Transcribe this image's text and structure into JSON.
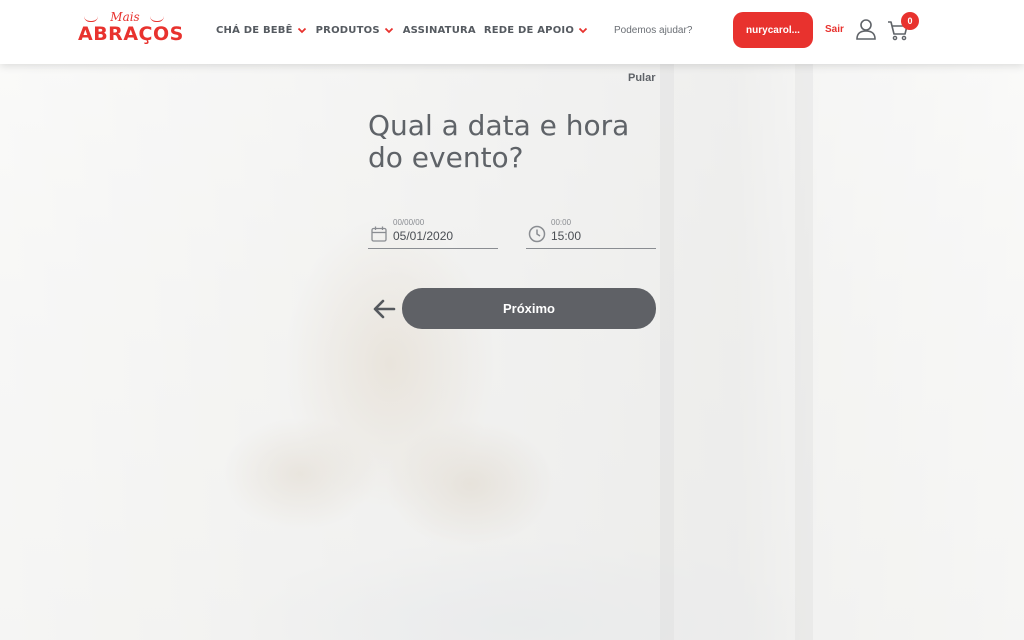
{
  "brand": {
    "logo_top": "Mais",
    "logo_main": "ABRAÇOS",
    "accent_color": "#e8322e"
  },
  "nav": {
    "items": [
      {
        "label": "CHÁ DE BEBÊ",
        "has_dropdown": true
      },
      {
        "label": "PRODUTOS",
        "has_dropdown": true
      },
      {
        "label": "ASSINATURA",
        "has_dropdown": false
      },
      {
        "label": "REDE DE APOIO",
        "has_dropdown": true
      }
    ]
  },
  "header": {
    "help_link": "Podemos ajudar?",
    "user_button": "nurycarol...",
    "logout": "Sair",
    "cart_count": "0",
    "user_icon": "user-icon",
    "cart_icon": "cart-icon"
  },
  "form": {
    "skip": "Pular",
    "question": "Qual a data e hora do evento?",
    "date_field": {
      "placeholder": "00/00/00",
      "value": "05/01/2020",
      "icon": "calendar-icon"
    },
    "time_field": {
      "placeholder": "00:00",
      "value": "15:00",
      "icon": "clock-icon"
    },
    "back_icon": "arrow-left-icon",
    "next_button": "Próximo",
    "next_button_color": "#5f6166"
  }
}
